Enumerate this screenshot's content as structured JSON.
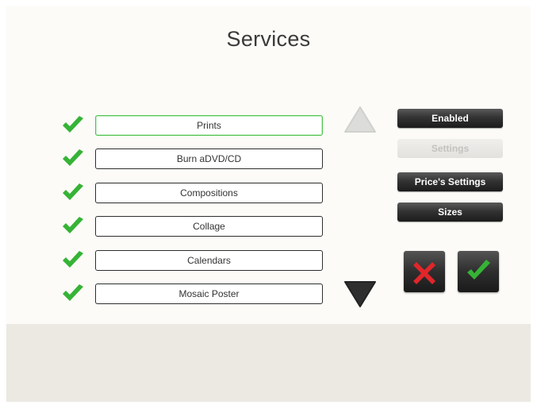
{
  "page": {
    "title": "Services"
  },
  "services": [
    {
      "label": "Prints",
      "enabled": true,
      "selected": true
    },
    {
      "label": "Burn aDVD/CD",
      "enabled": true,
      "selected": false
    },
    {
      "label": "Compositions",
      "enabled": true,
      "selected": false
    },
    {
      "label": "Collage",
      "enabled": true,
      "selected": false
    },
    {
      "label": "Calendars",
      "enabled": true,
      "selected": false
    },
    {
      "label": "Mosaic Poster",
      "enabled": true,
      "selected": false
    }
  ],
  "actions": {
    "enabled_label": "Enabled",
    "settings_label": "Settings",
    "price_settings_label": "Price's Settings",
    "sizes_label": "Sizes"
  },
  "icons": {
    "check": "check-icon",
    "scroll_up": "triangle-up-icon",
    "scroll_down": "triangle-down-icon",
    "cancel": "red-x-icon",
    "confirm": "green-check-icon"
  },
  "colors": {
    "check_green": "#36b336",
    "selected_border": "#4fc34f",
    "cancel_red": "#e0262a",
    "dark_button": "#2e2e2e"
  }
}
